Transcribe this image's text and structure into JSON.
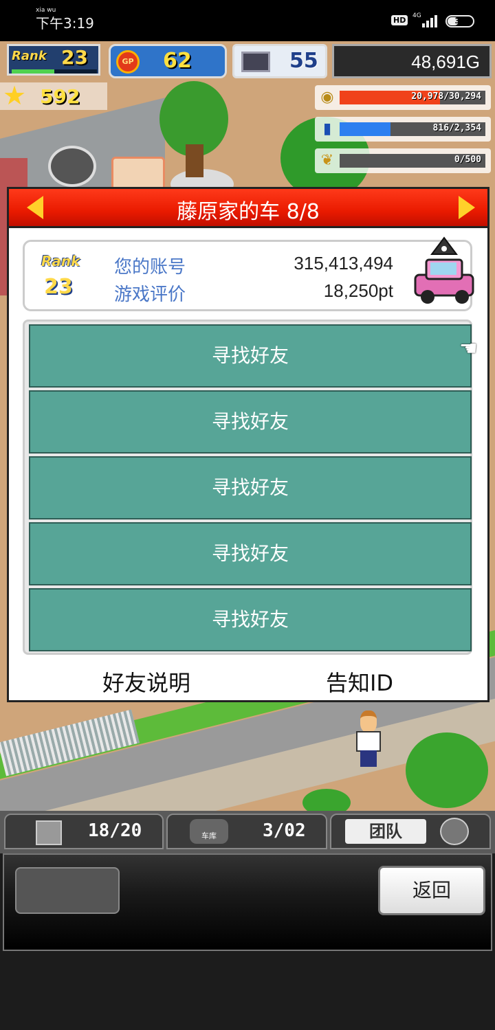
{
  "status_bar": {
    "time": "下午3:19",
    "time_pinyin": "xia wu",
    "hd": "HD",
    "network": "4G",
    "battery": "39"
  },
  "hud": {
    "rank_label": "Rank",
    "rank": "23",
    "rank_progress": 0.5,
    "gp_label": "GP",
    "gp": "62",
    "pc_count": "55",
    "gold": "48,691G",
    "stars": "592",
    "resources": [
      {
        "icon": "coin-stack-icon",
        "text": "20,978/30,294",
        "fraction": 0.69,
        "color": "#f0421a"
      },
      {
        "icon": "fuel-bottle-icon",
        "text": "816/2,354",
        "fraction": 0.35,
        "color": "#2d7ff0"
      },
      {
        "icon": "wheat-icon",
        "text": "0/500",
        "fraction": 0.0,
        "color": "#e0b030"
      }
    ]
  },
  "dialog": {
    "title": "藤原家的车 8/8",
    "rank_label": "Rank",
    "rank": "23",
    "account_label": "您的账号",
    "account_value": "315,413,494",
    "rating_label": "游戏评价",
    "rating_value": "18,250pt",
    "friend_slots": [
      "寻找好友",
      "寻找好友",
      "寻找好友",
      "寻找好友",
      "寻找好友"
    ],
    "friend_help": "好友说明",
    "notify_id": "告知ID"
  },
  "bottom_bar": {
    "tab1_value": "18/20",
    "garage_label": "车库",
    "tab2_value": "3/02",
    "team_label": "团队",
    "back": "返回"
  }
}
